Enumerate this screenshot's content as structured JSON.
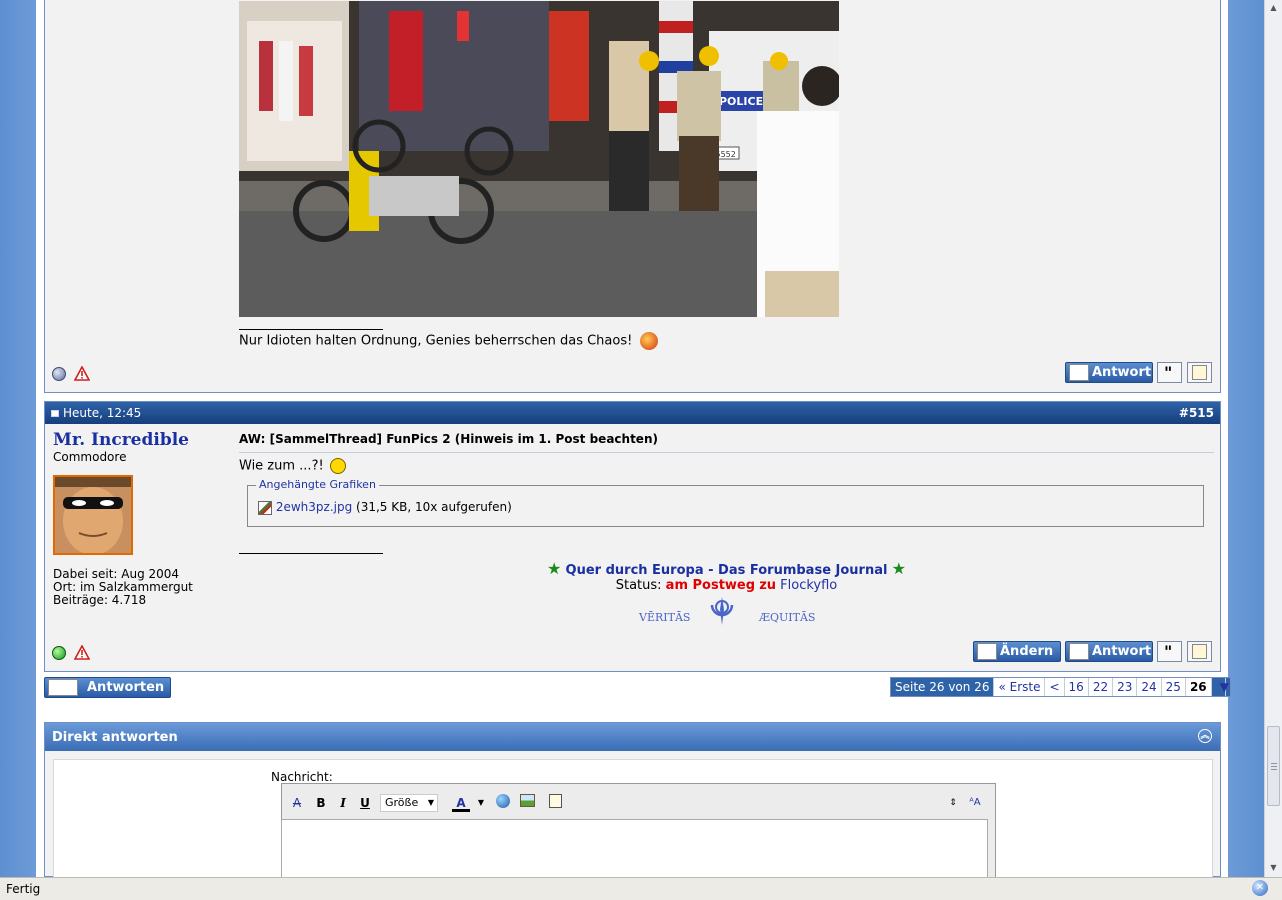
{
  "post_prev": {
    "signature": "Nur Idioten halten Ordnung, Genies beherrschen das Chaos!",
    "photo_text_police": "POLICE",
    "photo_text_plate": "A5552"
  },
  "post": {
    "date": "Heute, 12:45",
    "number": "#515",
    "username": "Mr. Incredible",
    "user_title": "Commodore",
    "joined": "Dabei seit: Aug 2004",
    "location": "Ort: im Salzkammergut",
    "posts": "Beiträge: 4.718",
    "title": "AW: [SammelThread] FunPics 2 (Hinweis im 1. Post beachten)",
    "text": "Wie zum ...?!",
    "attachments_legend": "Angehängte Grafiken",
    "attachment_name": "2ewh3pz.jpg",
    "attachment_meta": "(31,5 KB, 10x aufgerufen)",
    "sig_link": "Quer durch Europa - Das Forumbase Journal",
    "sig_status_prefix": "Status:",
    "sig_status_red": "am Postweg",
    "sig_status_zu": "zu",
    "sig_status_user": "Flockyflo",
    "sig_veritas": "VĒRITĀS",
    "sig_aequitas": "ÆQUITĀS"
  },
  "buttons": {
    "edit": "Ändern",
    "reply": "Antwort",
    "answers": "Antworten"
  },
  "pagination": {
    "label": "Seite 26 von 26",
    "first": "« Erste",
    "prev": "<",
    "pages": [
      "16",
      "22",
      "23",
      "24",
      "25"
    ],
    "current": "26"
  },
  "quick_reply": {
    "title": "Direkt antworten",
    "message_label": "Nachricht:",
    "size_label": "Größe"
  },
  "status_bar": {
    "text": "Fertig"
  },
  "colors": {
    "header_blue": "#163e7c",
    "link_blue": "#2233a4",
    "status_red": "#e00000",
    "star_green": "#1a8a1a"
  }
}
